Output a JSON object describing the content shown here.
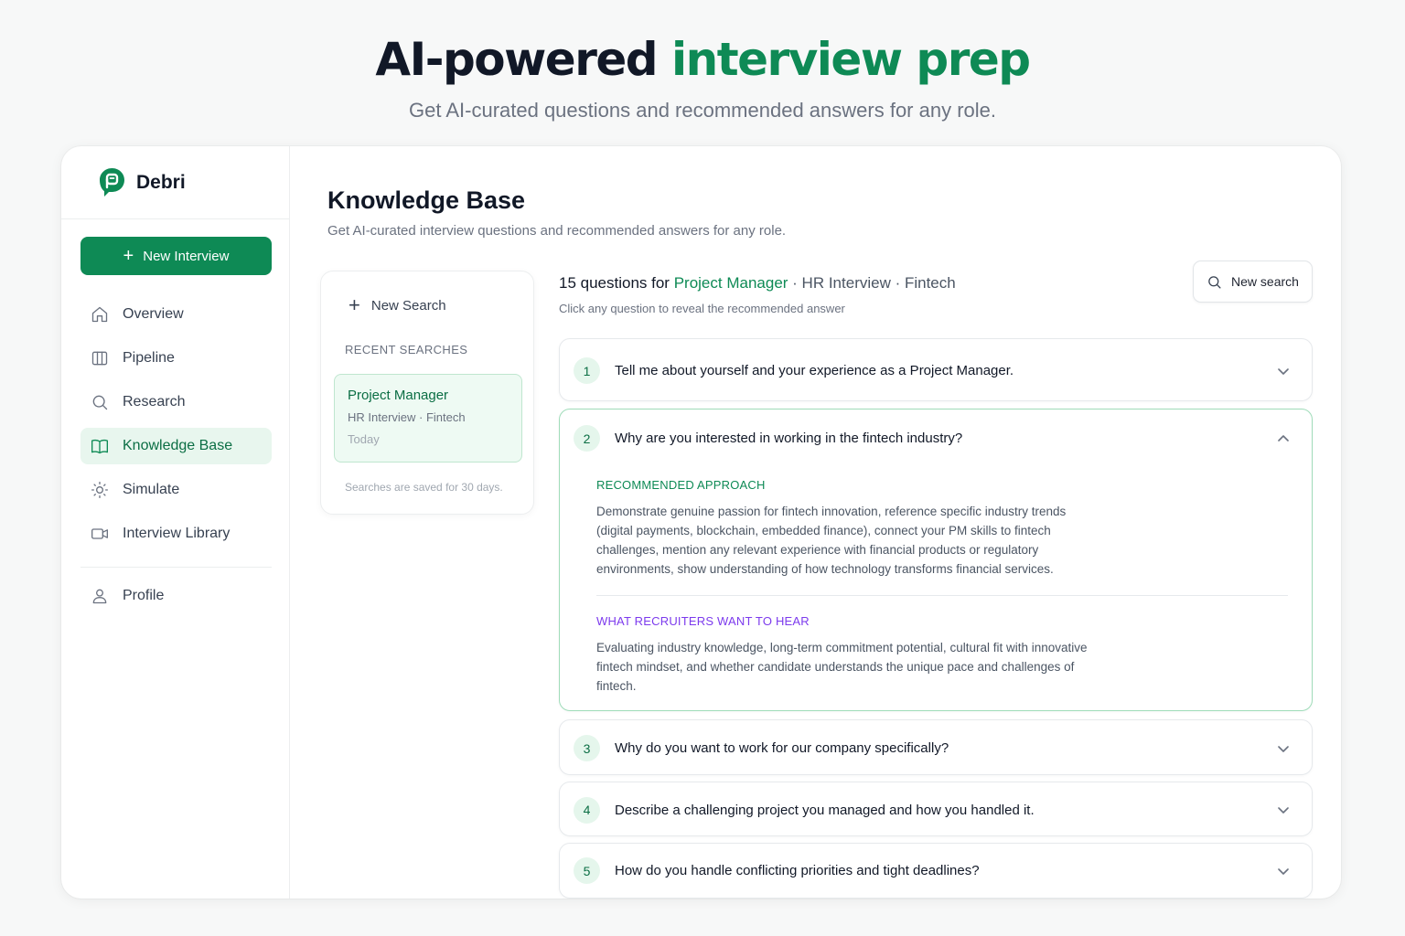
{
  "hero": {
    "title_main": "AI-powered",
    "title_accent": "interview prep",
    "subtitle": "Get AI-curated questions and recommended answers for any role."
  },
  "colors": {
    "accent_green": "#0e8a55",
    "accent_purple": "#7c3aed",
    "active_bg": "#e8f6ee"
  },
  "sidebar": {
    "brand": "Debri",
    "new_interview_label": "New Interview",
    "items": [
      {
        "label": "Overview",
        "icon": "home-icon",
        "active": false
      },
      {
        "label": "Pipeline",
        "icon": "columns-icon",
        "active": false
      },
      {
        "label": "Research",
        "icon": "search-icon",
        "active": false
      },
      {
        "label": "Knowledge Base",
        "icon": "book-icon",
        "active": true
      },
      {
        "label": "Simulate",
        "icon": "sun-icon",
        "active": false
      },
      {
        "label": "Interview Library",
        "icon": "video-icon",
        "active": false
      }
    ],
    "profile_label": "Profile"
  },
  "main": {
    "title": "Knowledge Base",
    "subtitle": "Get AI-curated interview questions and recommended answers for any role."
  },
  "search_panel": {
    "new_search_label": "New Search",
    "recent_heading": "RECENT SEARCHES",
    "recent": [
      {
        "title": "Project Manager",
        "meta": "HR Interview · Fintech",
        "date": "Today"
      }
    ],
    "note": "Searches are saved for 30 days."
  },
  "results": {
    "count_text": "15 questions for",
    "role": "Project Manager",
    "meta": "· HR Interview · Fintech",
    "hint": "Click any question to reveal the recommended answer",
    "new_search_label": "New search",
    "questions": [
      {
        "num": "1",
        "text": "Tell me about yourself and your experience as a Project Manager."
      },
      {
        "num": "2",
        "text": "Why are you interested in working in the fintech industry?",
        "approach_label": "RECOMMENDED APPROACH",
        "approach": "Demonstrate genuine passion for fintech innovation, reference specific industry trends (digital payments, blockchain, embedded finance), connect your PM skills to fintech challenges, mention any relevant experience with financial products or regulatory environments, show understanding of how technology transforms financial services.",
        "recruiters_label": "WHAT RECRUITERS WANT TO HEAR",
        "recruiters": "Evaluating industry knowledge, long-term commitment potential, cultural fit with innovative fintech mindset, and whether candidate understands the unique pace and challenges of fintech."
      },
      {
        "num": "3",
        "text": "Why do you want to work for our company specifically?"
      },
      {
        "num": "4",
        "text": "Describe a challenging project you managed and how you handled it."
      },
      {
        "num": "5",
        "text": "How do you handle conflicting priorities and tight deadlines?"
      }
    ]
  }
}
